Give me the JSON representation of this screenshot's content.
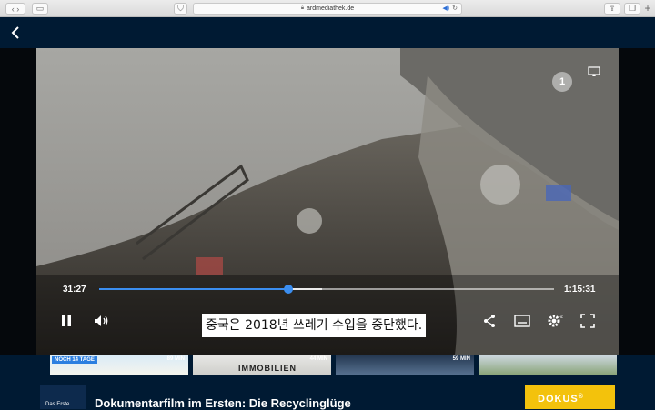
{
  "browser": {
    "url": "ardmediathek.de",
    "new_tab": "+"
  },
  "player": {
    "current_time": "31:27",
    "total_time": "1:15:31",
    "progress": 0.416,
    "buffered": 0.49,
    "subtitle": "중국은 2018년 쓰레기 수입을 중단했다.",
    "channel_logo": "1"
  },
  "thumbnails": [
    {
      "badge": "NOCH 14 TAGE",
      "duration": "89 MIN",
      "text": ""
    },
    {
      "badge": "",
      "duration": "44 MIN",
      "text": "IMMOBILIEN"
    },
    {
      "badge": "",
      "duration": "59 MIN",
      "text": ""
    },
    {
      "badge": "",
      "duration": "",
      "text": ""
    }
  ],
  "info": {
    "channel": "Das Erste",
    "title": "Dokumentarfilm im Ersten: Die Recyclinglüge",
    "brand": "DOKUS"
  },
  "colors": {
    "accent": "#3b8ef0",
    "background": "#001a33",
    "badge": "#2c7fe0",
    "brand_yellow": "#f3c20c"
  },
  "icons": [
    "back-icon",
    "pause-icon",
    "volume-icon",
    "share-icon",
    "subtitles-icon",
    "settings-icon",
    "fullscreen-icon",
    "cast-icon"
  ]
}
